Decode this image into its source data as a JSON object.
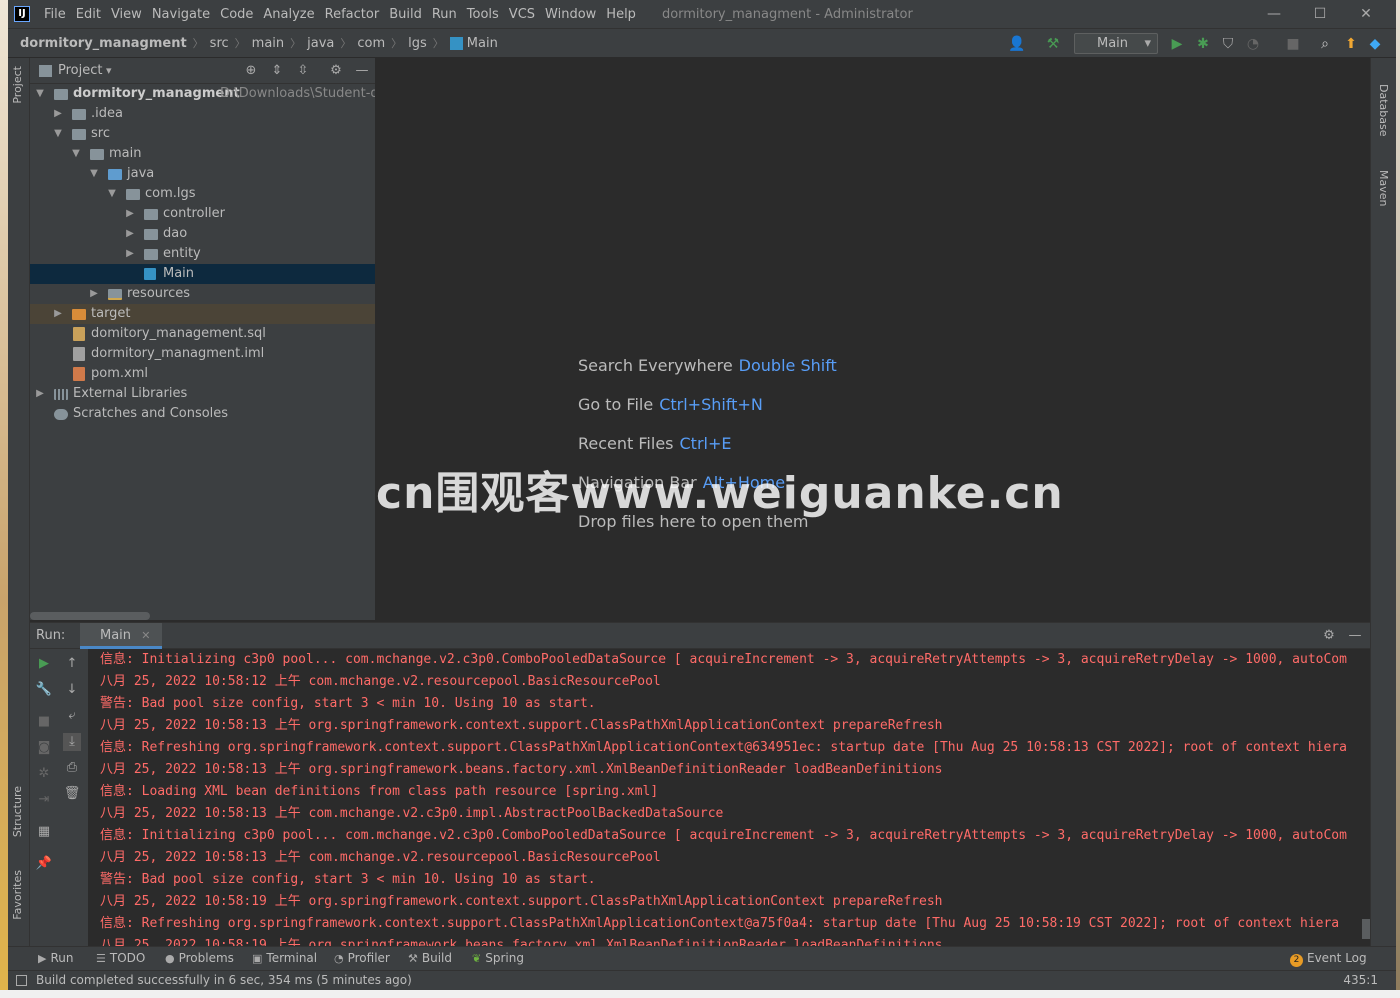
{
  "menubar": {
    "items": [
      "File",
      "Edit",
      "View",
      "Navigate",
      "Code",
      "Analyze",
      "Refactor",
      "Build",
      "Run",
      "Tools",
      "VCS",
      "Window",
      "Help"
    ],
    "window_title": "dormitory_managment - Administrator"
  },
  "navbar": {
    "crumbs": [
      "dormitory_managment",
      "src",
      "main",
      "java",
      "com",
      "lgs",
      "Main"
    ],
    "run_config": "Main"
  },
  "project": {
    "title": "Project",
    "tree": [
      {
        "label": "dormitory_managment",
        "path": "D:\\Downloads\\Student-dor"
      },
      {
        "label": ".idea"
      },
      {
        "label": "src"
      },
      {
        "label": "main"
      },
      {
        "label": "java"
      },
      {
        "label": "com.lgs"
      },
      {
        "label": "controller"
      },
      {
        "label": "dao"
      },
      {
        "label": "entity"
      },
      {
        "label": "Main"
      },
      {
        "label": "resources"
      },
      {
        "label": "target"
      },
      {
        "label": "domitory_management.sql"
      },
      {
        "label": "dormitory_managment.iml"
      },
      {
        "label": "pom.xml"
      },
      {
        "label": "External Libraries"
      },
      {
        "label": "Scratches and Consoles"
      }
    ]
  },
  "editor": {
    "hints": [
      {
        "text": "Search Everywhere",
        "key": "Double Shift"
      },
      {
        "text": "Go to File",
        "key": "Ctrl+Shift+N"
      },
      {
        "text": "Recent Files",
        "key": "Ctrl+E"
      },
      {
        "text": "Navigation Bar",
        "key": "Alt+Home"
      },
      {
        "text": "Drop files here to open them",
        "key": ""
      }
    ]
  },
  "watermark": "cn围观客www.weiguanke.cn",
  "run_panel": {
    "label": "Run:",
    "tab": "Main",
    "log": [
      "信息: Initializing c3p0 pool... com.mchange.v2.c3p0.ComboPooledDataSource [ acquireIncrement -> 3, acquireRetryAttempts -> 3, acquireRetryDelay -> 1000, autoCom",
      "八月 25, 2022 10:58:12 上午 com.mchange.v2.resourcepool.BasicResourcePool",
      "警告: Bad pool size config, start 3 < min 10. Using 10 as start.",
      "八月 25, 2022 10:58:13 上午 org.springframework.context.support.ClassPathXmlApplicationContext prepareRefresh",
      "信息: Refreshing org.springframework.context.support.ClassPathXmlApplicationContext@634951ec: startup date [Thu Aug 25 10:58:13 CST 2022]; root of context hiera",
      "八月 25, 2022 10:58:13 上午 org.springframework.beans.factory.xml.XmlBeanDefinitionReader loadBeanDefinitions",
      "信息: Loading XML bean definitions from class path resource [spring.xml]",
      "八月 25, 2022 10:58:13 上午 com.mchange.v2.c3p0.impl.AbstractPoolBackedDataSource",
      "信息: Initializing c3p0 pool... com.mchange.v2.c3p0.ComboPooledDataSource [ acquireIncrement -> 3, acquireRetryAttempts -> 3, acquireRetryDelay -> 1000, autoCom",
      "八月 25, 2022 10:58:13 上午 com.mchange.v2.resourcepool.BasicResourcePool",
      "警告: Bad pool size config, start 3 < min 10. Using 10 as start.",
      "八月 25, 2022 10:58:19 上午 org.springframework.context.support.ClassPathXmlApplicationContext prepareRefresh",
      "信息: Refreshing org.springframework.context.support.ClassPathXmlApplicationContext@a75f0a4: startup date [Thu Aug 25 10:58:19 CST 2022]; root of context hiera",
      "八月 25, 2022 10:58:19 上午 org.springframework.beans.factory.xml.XmlBeanDefinitionReader loadBeanDefinitions"
    ]
  },
  "side_tabs": {
    "left_top": "Project",
    "left_structure": "Structure",
    "left_favorites": "Favorites",
    "right_database": "Database",
    "right_maven": "Maven"
  },
  "bottom_tools": {
    "items": [
      "Run",
      "TODO",
      "Problems",
      "Terminal",
      "Profiler",
      "Build",
      "Spring"
    ],
    "event_log": "Event Log",
    "event_count": "2"
  },
  "status": {
    "message": "Build completed successfully in 6 sec, 354 ms (5 minutes ago)",
    "position": "435:1"
  },
  "colors": {
    "accent": "#589df6",
    "log_text": "#ff6b68",
    "selection": "#0d293e",
    "run_green": "#499c54"
  }
}
